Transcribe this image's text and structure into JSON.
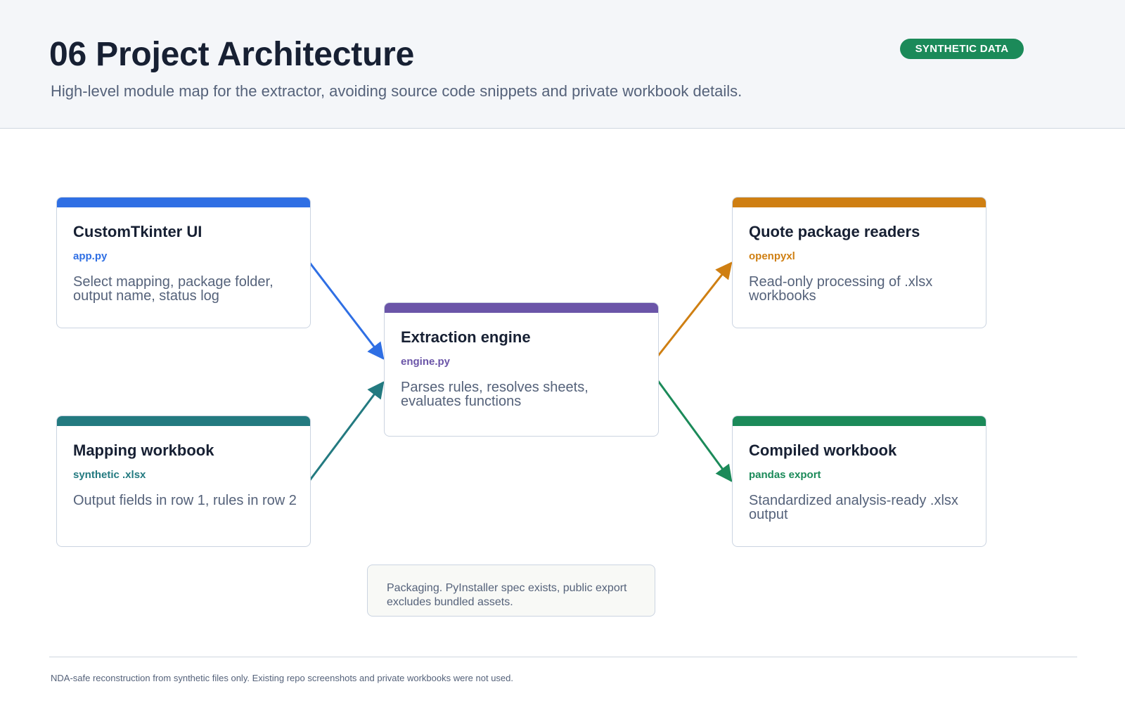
{
  "header": {
    "title": "06 Project Architecture",
    "subtitle": "High-level module map for the extractor, avoiding source code snippets and private workbook details.",
    "badge": "SYNTHETIC DATA"
  },
  "colors": {
    "ui": "#2f6fe4",
    "mapping": "#237a80",
    "engine": "#6b55a8",
    "readers": "#cf7f12",
    "compiled": "#1b8a59"
  },
  "nodes": {
    "ui": {
      "title": "CustomTkinter UI",
      "tech": "app.py",
      "desc": "Select mapping, package folder, output name, status log"
    },
    "mapping": {
      "title": "Mapping workbook",
      "tech": "synthetic .xlsx",
      "desc": "Output fields in row 1, rules in row 2"
    },
    "engine": {
      "title": "Extraction engine",
      "tech": "engine.py",
      "desc": "Parses rules, resolves sheets, evaluates functions"
    },
    "readers": {
      "title": "Quote package readers",
      "tech": "openpyxl",
      "desc": "Read-only processing of .xlsx workbooks"
    },
    "compiled": {
      "title": "Compiled workbook",
      "tech": "pandas export",
      "desc": "Standardized analysis-ready .xlsx output"
    }
  },
  "packaging": "Packaging. PyInstaller spec exists, public export excludes bundled assets.",
  "footer": "NDA-safe reconstruction from synthetic files only. Existing repo screenshots and private workbooks were not used."
}
